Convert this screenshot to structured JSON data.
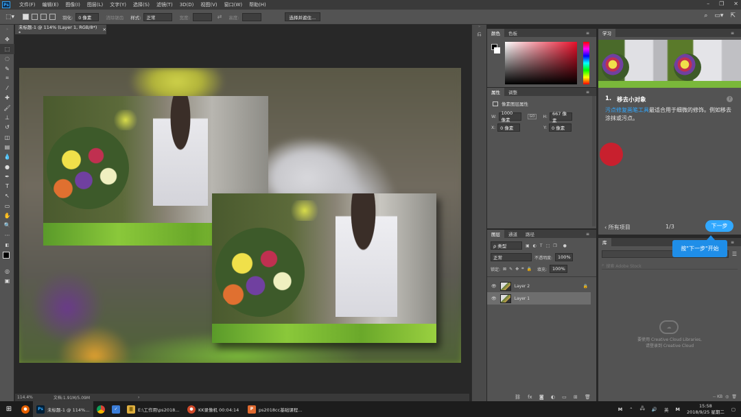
{
  "app": {
    "logo": "Ps"
  },
  "menubar": {
    "items": [
      "文件(F)",
      "编辑(E)",
      "图像(I)",
      "图层(L)",
      "文字(Y)",
      "选择(S)",
      "滤镜(T)",
      "3D(D)",
      "视图(V)",
      "窗口(W)",
      "帮助(H)"
    ]
  },
  "options": {
    "feather_label": "羽化:",
    "feather_value": "0 像素",
    "antialias_label": "消除锯齿",
    "style_label": "样式:",
    "style_value": "正常",
    "width_label": "宽度:",
    "height_label": "高度:",
    "select_mask_button": "选择并遮住..."
  },
  "document": {
    "tab_title": "未标题-1 @ 114% (Layer 1, RGB/8*) *",
    "close": "×"
  },
  "status": {
    "zoom": "114.4%",
    "doc_size": "文档:1.91M/5.09M"
  },
  "color_panel": {
    "tabs": [
      "颜色",
      "色板"
    ],
    "active_tab": "颜色"
  },
  "properties_panel": {
    "tabs": [
      "属性",
      "调整"
    ],
    "section_title": "像素图层属性",
    "w_label": "W:",
    "w_value": "1000 像素",
    "h_label": "H:",
    "h_value": "667 像素",
    "x_label": "X:",
    "x_value": "0 像素",
    "y_label": "Y:",
    "y_value": "0 像素",
    "link_symbol": "GO"
  },
  "layers_panel": {
    "tabs": [
      "图层",
      "通道",
      "路径"
    ],
    "filter_kind": "ρ 类型",
    "blend_mode": "正常",
    "opacity_label": "不透明度:",
    "opacity_value": "100%",
    "lock_label": "锁定:",
    "fill_label": "填充:",
    "fill_value": "100%",
    "layers": [
      {
        "name": "Layer 2",
        "selected": false
      },
      {
        "name": "Layer 1",
        "selected": true
      }
    ],
    "footer_icons": [
      "link-icon",
      "fx-icon",
      "mask-icon",
      "adjustment-icon",
      "folder-icon",
      "new-layer-icon",
      "trash-icon"
    ],
    "footer_fx": "fx"
  },
  "learn_panel": {
    "tab": "学习",
    "step_number": "1.",
    "step_title": "移去小对象",
    "desc_link": "污点修复画笔工具",
    "desc_rest": "最适合用于细微的修饰。例如移去涂抹或污点。",
    "back_label": "‹ 所有项目",
    "progress": "1/3",
    "next_button": "下一步",
    "tooltip": "按\"下一步\"开始"
  },
  "library_panel": {
    "tab": "库",
    "search_placeholder": "搜索 Adobe Stock",
    "cc_message_line1": "要使用 Creative Cloud Libraries,",
    "cc_message_line2": "请登录到 Creative Cloud",
    "size_label": "-- KB"
  },
  "taskbar": {
    "items": [
      {
        "label": "未标题-1 @ 114%...",
        "color": "#31a8ff",
        "glyph": "Ps"
      },
      {
        "label": "E:\\工作用\\ps2018...",
        "color": "#e0b040",
        "glyph": "▇"
      },
      {
        "label": "KK录像机 00:04:14",
        "color": "#d04a2a",
        "glyph": "●"
      },
      {
        "label": "ps2018cc基础课程...",
        "color": "#e06a30",
        "glyph": "P"
      }
    ],
    "tray": {
      "m1": "M",
      "ime": "英",
      "m2": "M",
      "time": "15:58",
      "date": "2018/9/25 星期二"
    }
  },
  "colors": {
    "accent": "#31a8ff",
    "chrome": "#535353",
    "canvas_bg": "#282828",
    "pointer_dot": "#c8202e"
  }
}
